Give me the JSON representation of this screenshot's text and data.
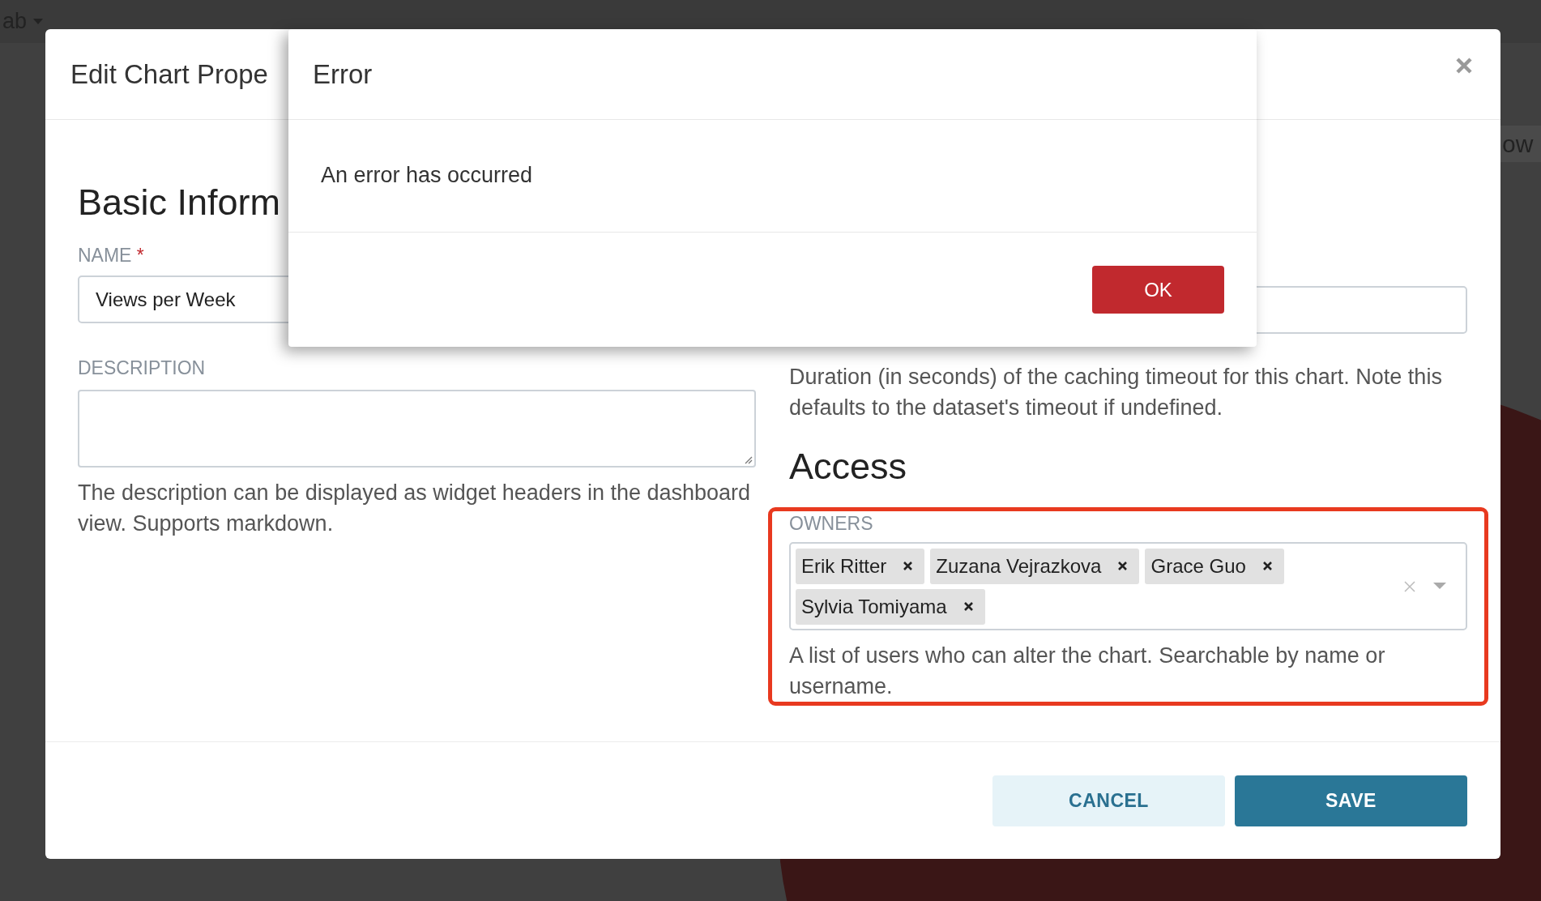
{
  "background": {
    "menu": "ab",
    "side_text": "ow"
  },
  "modal": {
    "title": "Edit Chart Prope",
    "basic_heading": "Basic Inform",
    "name_label": "NAME",
    "required_mark": "*",
    "name_value": "Views per Week",
    "description_label": "DESCRIPTION",
    "description_help": "The description can be displayed as widget headers in the dashboard view. Supports markdown.",
    "timeout_help": "Duration (in seconds) of the caching timeout for this chart. Note this defaults to the dataset's timeout if undefined.",
    "access_heading": "Access",
    "owners": {
      "label": "OWNERS",
      "highlighted": true,
      "selected": [
        "Erik Ritter",
        "Zuzana Vejrazkova",
        "Grace Guo",
        "Sylvia Tomiyama"
      ],
      "help": "A list of users who can alter the chart. Searchable by name or username."
    },
    "buttons": [
      {
        "label": "CANCEL",
        "kind": "secondary"
      },
      {
        "label": "SAVE",
        "kind": "primary"
      }
    ]
  },
  "error_dialog": {
    "title": "Error",
    "message": "An error has occurred",
    "button": "OK"
  }
}
